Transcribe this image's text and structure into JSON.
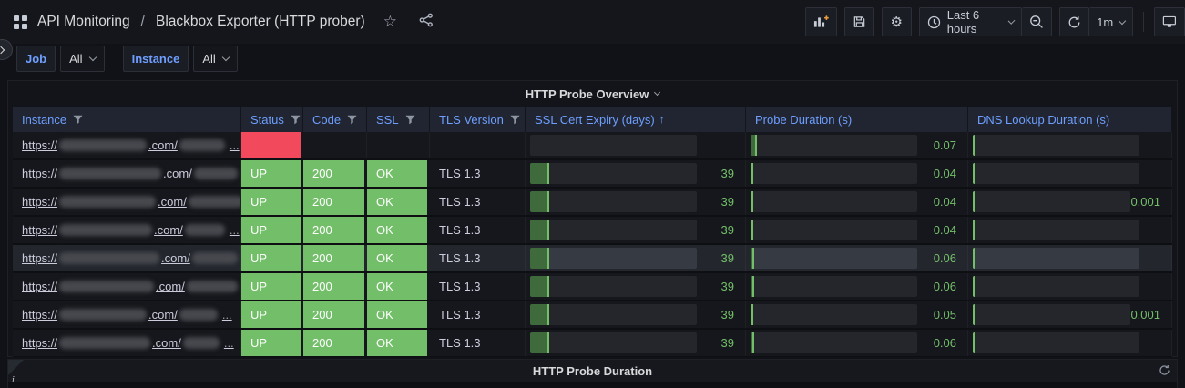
{
  "nav": {
    "folder": "API Monitoring",
    "separator": "/",
    "title": "Blackbox Exporter (HTTP prober)"
  },
  "toolbar": {
    "time_range": "Last 6 hours",
    "interval": "1m"
  },
  "variables": [
    {
      "label": "Job",
      "value": "All"
    },
    {
      "label": "Instance",
      "value": "All"
    }
  ],
  "panels": {
    "overview": {
      "title": "HTTP Probe Overview"
    },
    "duration": {
      "title": "HTTP Probe Duration"
    }
  },
  "colors": {
    "green": "#73bf69",
    "red": "#f2495c",
    "accent_blue": "#6e9fff",
    "value_green": "#73bf69"
  },
  "table": {
    "columns": [
      {
        "label": "Instance",
        "filterable": true
      },
      {
        "label": "Status",
        "filterable": true
      },
      {
        "label": "Code",
        "filterable": true
      },
      {
        "label": "SSL",
        "filterable": true
      },
      {
        "label": "TLS Version",
        "filterable": true
      },
      {
        "label": "SSL Cert Expiry (days)",
        "filterable": false,
        "sort": "asc"
      },
      {
        "label": "Probe Duration (s)",
        "filterable": false
      },
      {
        "label": "DNS Lookup Duration (s)",
        "filterable": false
      }
    ],
    "sort_indicator": "↑",
    "rows": [
      {
        "url": {
          "prefix": "https://",
          "tld": ".com/",
          "host_w": 96,
          "path_w": 50,
          "ellipsis": "..."
        },
        "status": "",
        "status_color": "red",
        "code": "",
        "code_color": null,
        "ssl": "",
        "ssl_color": null,
        "tls": "",
        "cert": {
          "pct": 0,
          "text": ""
        },
        "probe": {
          "pct": 4,
          "text": "0.07"
        },
        "dns": {
          "pct": 1,
          "text": ""
        },
        "highlight": false
      },
      {
        "url": {
          "prefix": "https://",
          "tld": ".com/",
          "host_w": 112,
          "path_w": 48,
          "ellipsis": "."
        },
        "status": "UP",
        "status_color": "green",
        "code": "200",
        "code_color": "green",
        "ssl": "OK",
        "ssl_color": "green",
        "tls": "TLS 1.3",
        "cert": {
          "pct": 11.5,
          "text": "39"
        },
        "probe": {
          "pct": 1.5,
          "text": "0.04"
        },
        "dns": {
          "pct": 1,
          "text": ""
        },
        "highlight": false
      },
      {
        "url": {
          "prefix": "https://",
          "tld": ".com/",
          "host_w": 106,
          "path_w": 60,
          "ellipsis": "..."
        },
        "status": "UP",
        "status_color": "green",
        "code": "200",
        "code_color": "green",
        "ssl": "OK",
        "ssl_color": "green",
        "tls": "TLS 1.3",
        "cert": {
          "pct": 11.5,
          "text": "39"
        },
        "probe": {
          "pct": 1.5,
          "text": "0.04"
        },
        "dns": {
          "pct": 1,
          "text": "0.001"
        },
        "highlight": false
      },
      {
        "url": {
          "prefix": "https://",
          "tld": ".com/",
          "host_w": 102,
          "path_w": 44,
          "ellipsis": "..."
        },
        "status": "UP",
        "status_color": "green",
        "code": "200",
        "code_color": "green",
        "ssl": "OK",
        "ssl_color": "green",
        "tls": "TLS 1.3",
        "cert": {
          "pct": 11.5,
          "text": "39"
        },
        "probe": {
          "pct": 1.5,
          "text": "0.04"
        },
        "dns": {
          "pct": 1,
          "text": ""
        },
        "highlight": false
      },
      {
        "url": {
          "prefix": "https://",
          "tld": ".com/",
          "host_w": 110,
          "path_w": 50,
          "ellipsis": ".."
        },
        "status": "UP",
        "status_color": "green",
        "code": "200",
        "code_color": "green",
        "ssl": "OK",
        "ssl_color": "green",
        "tls": "TLS 1.3",
        "cert": {
          "pct": 11.5,
          "text": "39"
        },
        "probe": {
          "pct": 2,
          "text": "0.06"
        },
        "dns": {
          "pct": 1,
          "text": ""
        },
        "highlight": true
      },
      {
        "url": {
          "prefix": "https://",
          "tld": ".com/",
          "host_w": 104,
          "path_w": 56,
          "ellipsis": "..."
        },
        "status": "UP",
        "status_color": "green",
        "code": "200",
        "code_color": "green",
        "ssl": "OK",
        "ssl_color": "green",
        "tls": "TLS 1.3",
        "cert": {
          "pct": 11.5,
          "text": "39"
        },
        "probe": {
          "pct": 2,
          "text": "0.06"
        },
        "dns": {
          "pct": 1,
          "text": ""
        },
        "highlight": false
      },
      {
        "url": {
          "prefix": "https://",
          "tld": ".com/",
          "host_w": 96,
          "path_w": 42,
          "ellipsis": "..."
        },
        "status": "UP",
        "status_color": "green",
        "code": "200",
        "code_color": "green",
        "ssl": "OK",
        "ssl_color": "green",
        "tls": "TLS 1.3",
        "cert": {
          "pct": 11.5,
          "text": "39"
        },
        "probe": {
          "pct": 1.8,
          "text": "0.05"
        },
        "dns": {
          "pct": 1,
          "text": "0.001"
        },
        "highlight": false
      },
      {
        "url": {
          "prefix": "https://",
          "tld": ".com/",
          "host_w": 100,
          "path_w": 40,
          "ellipsis": "..."
        },
        "status": "UP",
        "status_color": "green",
        "code": "200",
        "code_color": "green",
        "ssl": "OK",
        "ssl_color": "green",
        "tls": "TLS 1.3",
        "cert": {
          "pct": 11.5,
          "text": "39"
        },
        "probe": {
          "pct": 2,
          "text": "0.06"
        },
        "dns": {
          "pct": 1,
          "text": ""
        },
        "highlight": false
      }
    ]
  }
}
